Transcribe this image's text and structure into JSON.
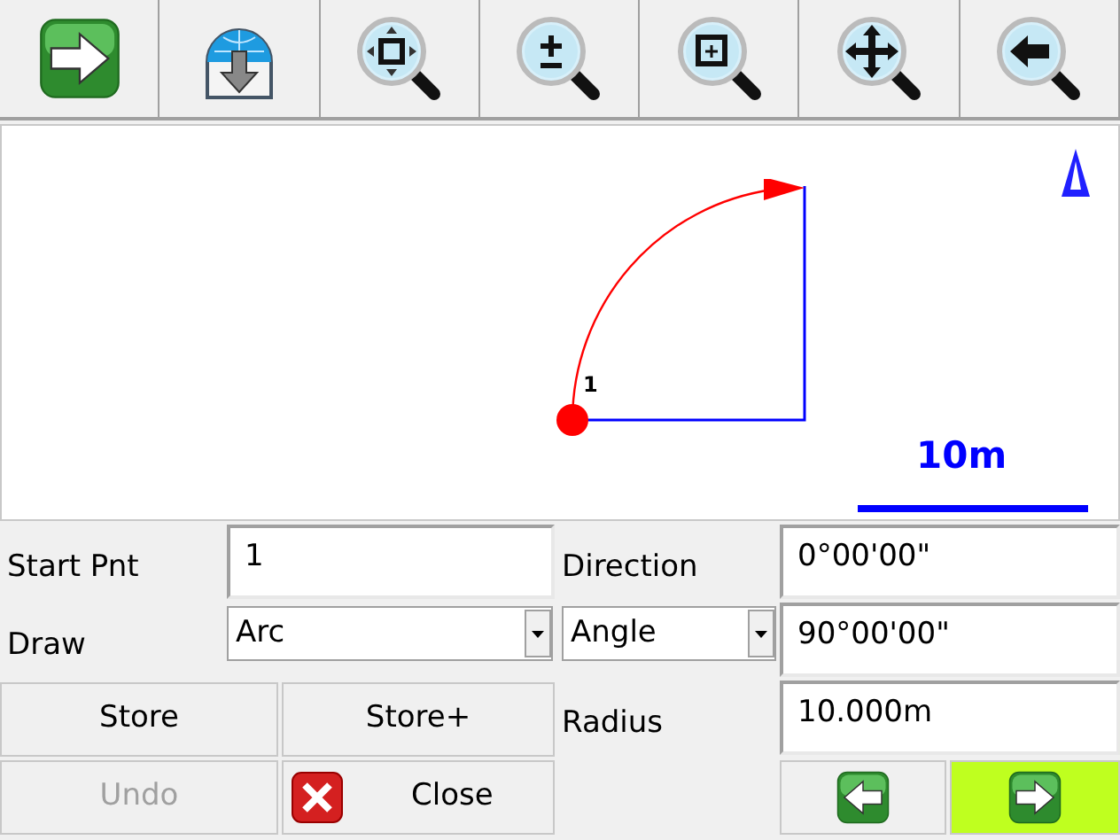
{
  "map": {
    "point_label": "1",
    "scale_label": "10m"
  },
  "form": {
    "start_point": {
      "label": "Start Pnt",
      "value": "1"
    },
    "direction": {
      "label": "Direction",
      "value": "0°00'00\""
    },
    "draw": {
      "label": "Draw",
      "value": "Arc"
    },
    "angle_mode": {
      "value": "Angle"
    },
    "angle": {
      "value": "90°00'00\""
    },
    "radius": {
      "label": "Radius",
      "value": "10.000m"
    }
  },
  "buttons": [
    {
      "label": "Store",
      "disabled": false
    },
    {
      "label": "Store+",
      "disabled": false
    },
    {
      "label": "Undo",
      "disabled": true
    },
    {
      "label": "Close",
      "disabled": false
    }
  ],
  "nav": {
    "next_highlighted": true
  }
}
